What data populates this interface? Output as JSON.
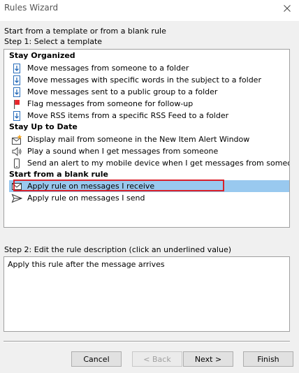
{
  "window": {
    "title": "Rules Wizard",
    "close_icon": "close-icon"
  },
  "intro_text": "Start from a template or from a blank rule",
  "step1_label": "Step 1: Select a template",
  "templates": {
    "groups": [
      {
        "title": "Stay Organized",
        "items": [
          {
            "label": "Move messages from someone to a folder",
            "icon": "move-to-folder-icon"
          },
          {
            "label": "Move messages with specific words in the subject to a folder",
            "icon": "move-to-folder-icon"
          },
          {
            "label": "Move messages sent to a public group to a folder",
            "icon": "move-to-folder-icon"
          },
          {
            "label": "Flag messages from someone for follow-up",
            "icon": "red-flag-icon"
          },
          {
            "label": "Move RSS items from a specific RSS Feed to a folder",
            "icon": "move-to-folder-icon"
          }
        ]
      },
      {
        "title": "Stay Up to Date",
        "items": [
          {
            "label": "Display mail from someone in the New Item Alert Window",
            "icon": "new-item-alert-icon"
          },
          {
            "label": "Play a sound when I get messages from someone",
            "icon": "speaker-icon"
          },
          {
            "label": "Send an alert to my mobile device when I get messages from someone",
            "icon": "mobile-phone-icon"
          }
        ]
      },
      {
        "title": "Start from a blank rule",
        "items": [
          {
            "label": "Apply rule on messages I receive",
            "icon": "envelope-icon",
            "selected": true
          },
          {
            "label": "Apply rule on messages I send",
            "icon": "send-icon"
          }
        ]
      }
    ]
  },
  "step2_label": "Step 2: Edit the rule description (click an underlined value)",
  "description": "Apply this rule after the message arrives",
  "buttons": {
    "cancel": "Cancel",
    "back": "< Back",
    "next": "Next >",
    "finish": "Finish"
  },
  "colors": {
    "selection": "#99c9ef",
    "highlight_outline": "#d9202a",
    "flag": "#e8262c",
    "icon_blue": "#2a6ebb"
  }
}
